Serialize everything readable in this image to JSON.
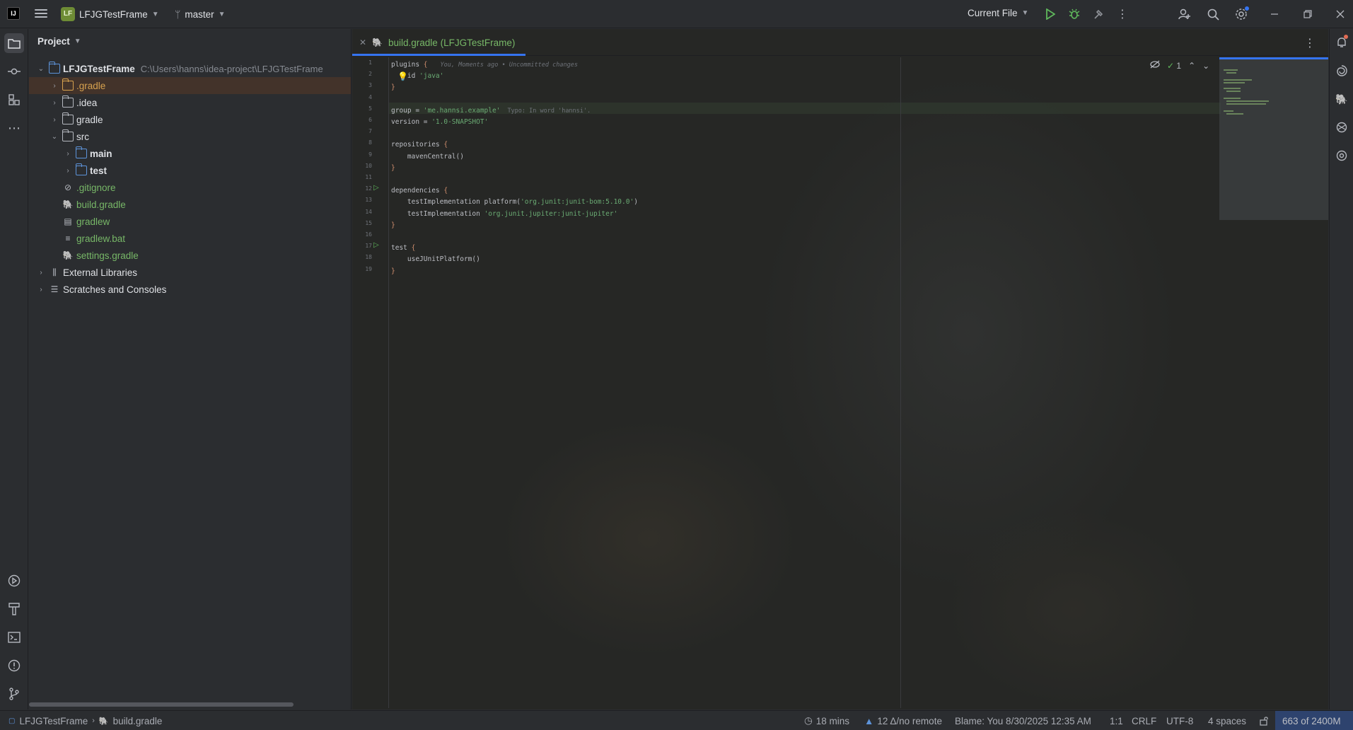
{
  "titlebar": {
    "app_icon": "intellij-idea-icon",
    "project_badge": "LF",
    "project_name": "LFJGTestFrame",
    "branch": "master",
    "run_config": "Current File"
  },
  "project_panel": {
    "title": "Project",
    "tree": [
      {
        "label": "LFJGTestFrame",
        "path": "C:\\Users\\hanns\\idea-project\\LFJGTestFrame",
        "depth": 0,
        "expanded": true,
        "icon": "folder-module-icon",
        "style": "bold"
      },
      {
        "label": ".gradle",
        "depth": 1,
        "expanded": false,
        "icon": "folder-icon",
        "style": "ignored",
        "selected": true
      },
      {
        "label": ".idea",
        "depth": 1,
        "expanded": false,
        "icon": "folder-icon",
        "style": "normal"
      },
      {
        "label": "gradle",
        "depth": 1,
        "expanded": false,
        "icon": "folder-icon",
        "style": "normal"
      },
      {
        "label": "src",
        "depth": 1,
        "expanded": true,
        "icon": "folder-icon",
        "style": "normal"
      },
      {
        "label": "main",
        "depth": 2,
        "expanded": false,
        "icon": "source-folder-icon",
        "style": "bold"
      },
      {
        "label": "test",
        "depth": 2,
        "expanded": false,
        "icon": "test-folder-icon",
        "style": "bold"
      },
      {
        "label": ".gitignore",
        "depth": 1,
        "leaf": true,
        "icon": "ignore-file-icon",
        "style": "green"
      },
      {
        "label": "build.gradle",
        "depth": 1,
        "leaf": true,
        "icon": "gradle-file-icon",
        "style": "green"
      },
      {
        "label": "gradlew",
        "depth": 1,
        "leaf": true,
        "icon": "script-file-icon",
        "style": "green"
      },
      {
        "label": "gradlew.bat",
        "depth": 1,
        "leaf": true,
        "icon": "text-file-icon",
        "style": "green"
      },
      {
        "label": "settings.gradle",
        "depth": 1,
        "leaf": true,
        "icon": "gradle-file-icon",
        "style": "green"
      },
      {
        "label": "External Libraries",
        "depth": 0,
        "expanded": false,
        "icon": "library-icon",
        "style": "normal"
      },
      {
        "label": "Scratches and Consoles",
        "depth": 0,
        "expanded": false,
        "icon": "scratches-icon",
        "style": "normal"
      }
    ]
  },
  "editor": {
    "tab_label": "build.gradle (LFJGTestFrame)",
    "inspection_count": "1",
    "blame_inlay": "You, Moments ago • Uncommitted changes",
    "typo_inlay": "Typo: In word 'hannsi'.",
    "lines": [
      {
        "n": "1",
        "tokens": [
          [
            "fn",
            "plugins "
          ],
          [
            "kw",
            "{"
          ]
        ],
        "run": false
      },
      {
        "n": "2",
        "tokens": [
          [
            "fn",
            "    id "
          ],
          [
            "str",
            "'java'"
          ]
        ],
        "run": false
      },
      {
        "n": "3",
        "tokens": [
          [
            "kw",
            "}"
          ]
        ],
        "run": false
      },
      {
        "n": "4",
        "tokens": [],
        "run": false
      },
      {
        "n": "5",
        "tokens": [
          [
            "fn",
            "group = "
          ],
          [
            "str",
            "'me.hannsi.example'"
          ]
        ],
        "run": false
      },
      {
        "n": "6",
        "tokens": [
          [
            "fn",
            "version = "
          ],
          [
            "str",
            "'1.0-SNAPSHOT'"
          ]
        ],
        "run": false
      },
      {
        "n": "7",
        "tokens": [],
        "run": false
      },
      {
        "n": "8",
        "tokens": [
          [
            "fn",
            "repositories "
          ],
          [
            "kw",
            "{"
          ]
        ],
        "run": false
      },
      {
        "n": "9",
        "tokens": [
          [
            "fn",
            "    mavenCentral()"
          ]
        ],
        "run": false
      },
      {
        "n": "10",
        "tokens": [
          [
            "kw",
            "}"
          ]
        ],
        "run": false
      },
      {
        "n": "11",
        "tokens": [],
        "run": false
      },
      {
        "n": "12",
        "tokens": [
          [
            "fn",
            "dependencies "
          ],
          [
            "kw",
            "{"
          ]
        ],
        "run": true
      },
      {
        "n": "13",
        "tokens": [
          [
            "fn",
            "    testImplementation platform("
          ],
          [
            "str",
            "'org.junit:junit-bom:5.10.0'"
          ],
          [
            "fn",
            ")"
          ]
        ],
        "run": false
      },
      {
        "n": "14",
        "tokens": [
          [
            "fn",
            "    testImplementation "
          ],
          [
            "str",
            "'org.junit.jupiter:junit-jupiter'"
          ]
        ],
        "run": false
      },
      {
        "n": "15",
        "tokens": [
          [
            "kw",
            "}"
          ]
        ],
        "run": false
      },
      {
        "n": "16",
        "tokens": [],
        "run": false
      },
      {
        "n": "17",
        "tokens": [
          [
            "fn",
            "test "
          ],
          [
            "kw",
            "{"
          ]
        ],
        "run": true
      },
      {
        "n": "18",
        "tokens": [
          [
            "fn",
            "    useJUnitPlatform()"
          ]
        ],
        "run": false
      },
      {
        "n": "19",
        "tokens": [
          [
            "kw",
            "}"
          ]
        ],
        "run": false
      }
    ]
  },
  "statusbar": {
    "crumb_project": "LFJGTestFrame",
    "crumb_file": "build.gradle",
    "time": "18 mins",
    "vcs": "12 Δ/no remote",
    "blame": "Blame: You 8/30/2025 12:35 AM",
    "position": "1:1",
    "line_sep": "CRLF",
    "encoding": "UTF-8",
    "indent": "4 spaces",
    "memory": "663 of 2400M"
  }
}
